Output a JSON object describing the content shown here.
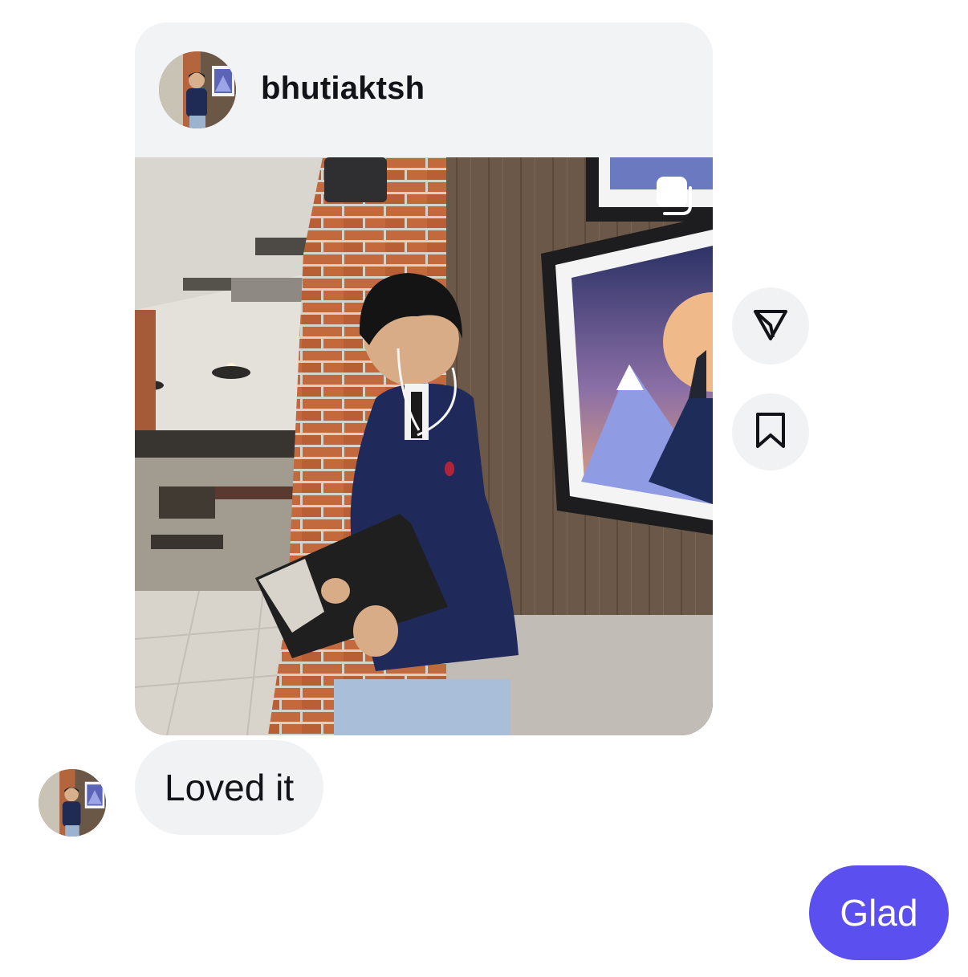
{
  "shared_post": {
    "username": "bhutiaktsh",
    "is_carousel": true
  },
  "actions": {
    "share_icon": "send-icon",
    "save_icon": "bookmark-icon"
  },
  "messages": {
    "incoming": "Loved it",
    "outgoing": "Glad"
  },
  "colors": {
    "outgoing_bubble": "#5b4ff0",
    "incoming_bubble": "#f1f2f4",
    "card_header": "#f2f3f5"
  }
}
